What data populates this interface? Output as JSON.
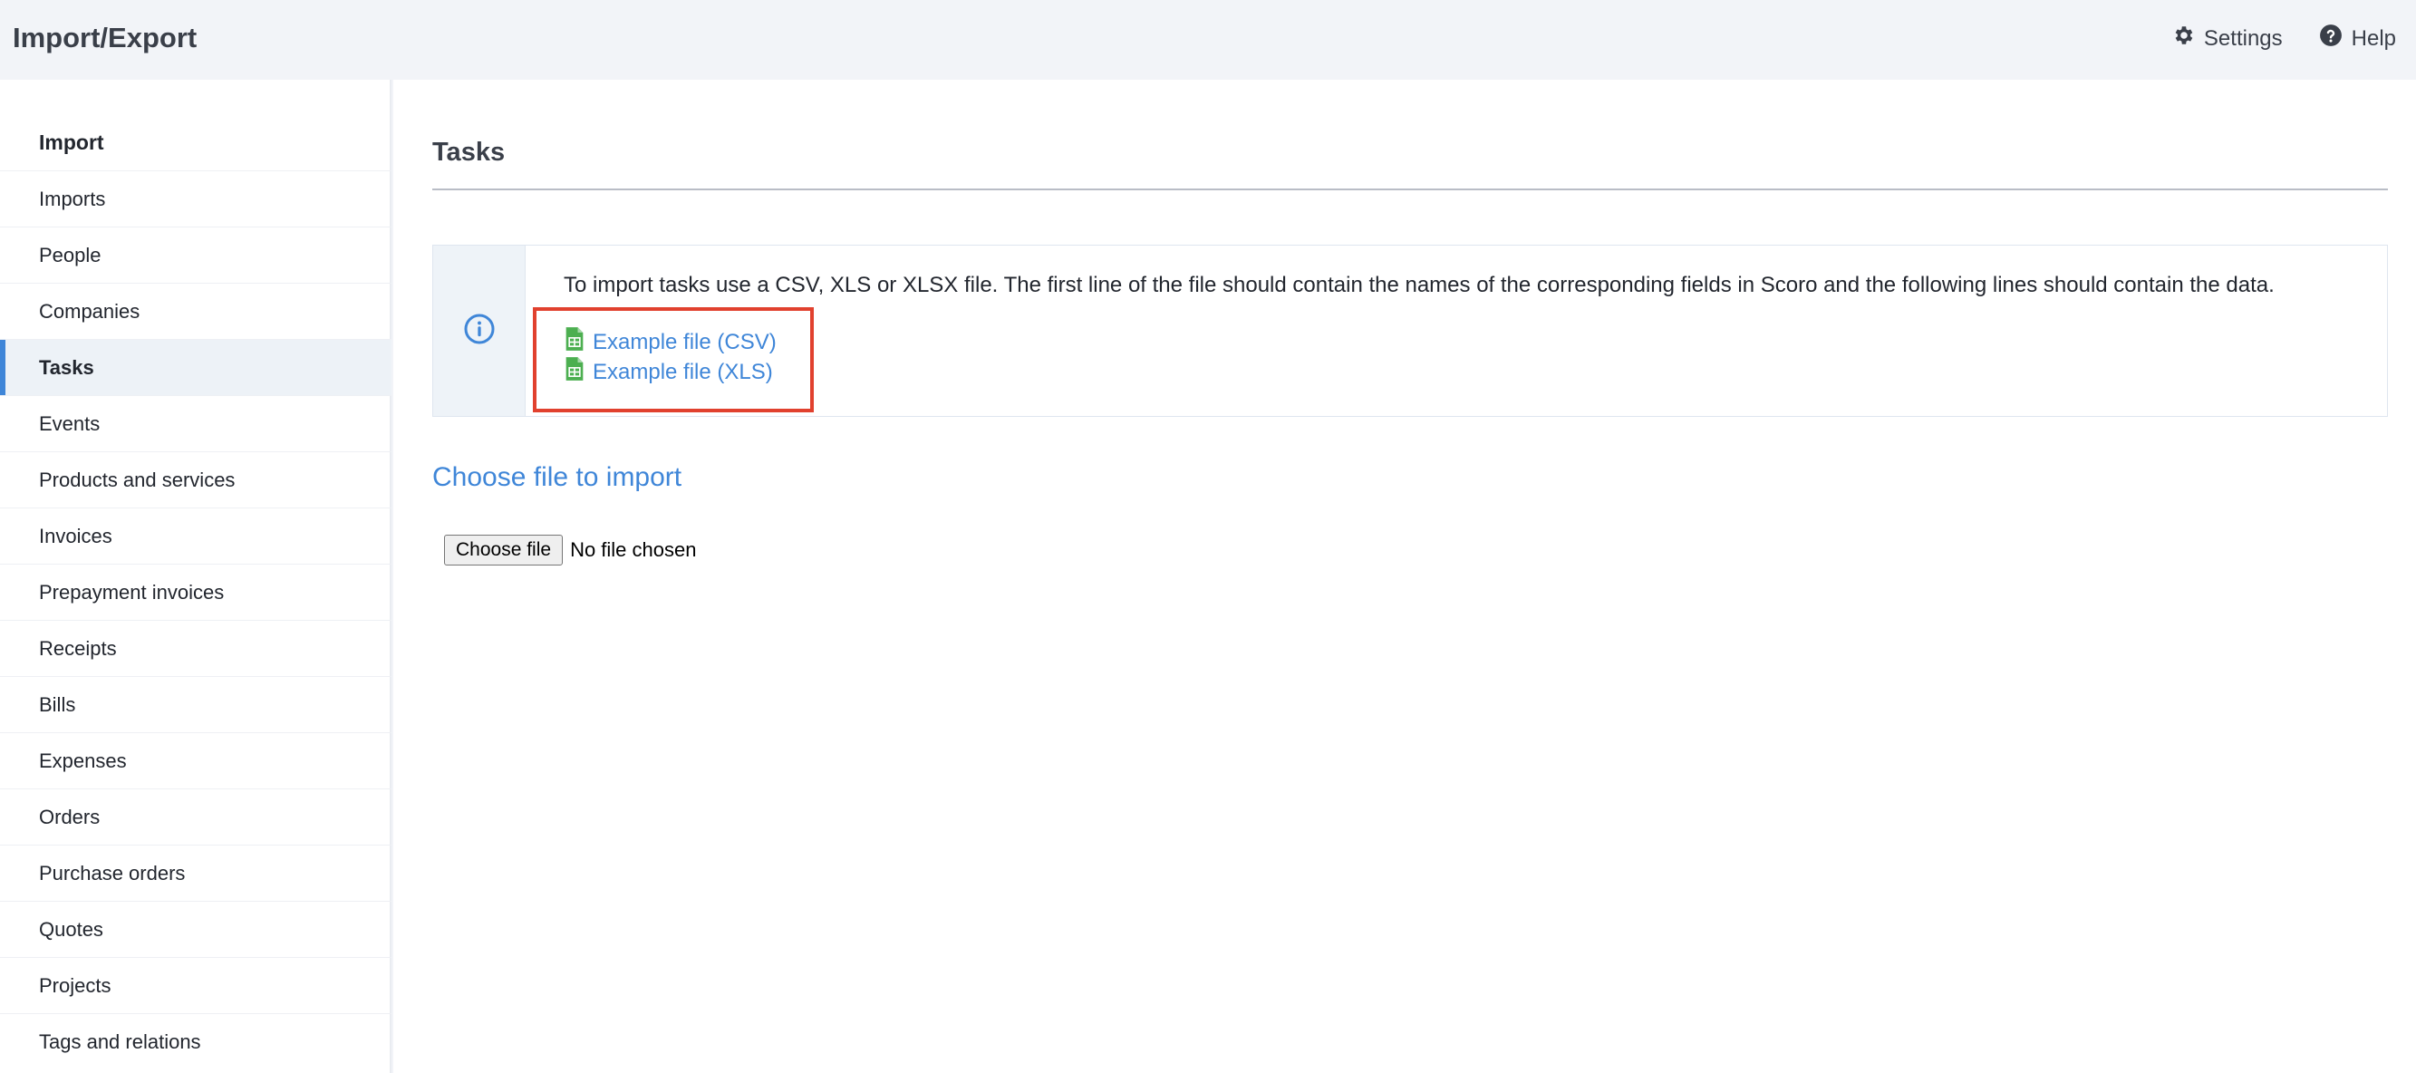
{
  "header": {
    "title": "Import/Export",
    "settings_label": "Settings",
    "help_label": "Help"
  },
  "sidebar": {
    "heading": "Import",
    "items": [
      {
        "label": "Imports"
      },
      {
        "label": "People"
      },
      {
        "label": "Companies"
      },
      {
        "label": "Tasks",
        "active": true
      },
      {
        "label": "Events"
      },
      {
        "label": "Products and services"
      },
      {
        "label": "Invoices"
      },
      {
        "label": "Prepayment invoices"
      },
      {
        "label": "Receipts"
      },
      {
        "label": "Bills"
      },
      {
        "label": "Expenses"
      },
      {
        "label": "Orders"
      },
      {
        "label": "Purchase orders"
      },
      {
        "label": "Quotes"
      },
      {
        "label": "Projects"
      },
      {
        "label": "Tags and relations"
      }
    ]
  },
  "main": {
    "title": "Tasks",
    "info_text": "To import tasks use a CSV, XLS or XLSX file. The first line of the file should contain the names of the corresponding fields in Scoro and the following lines should contain the data.",
    "example_csv": "Example file (CSV)",
    "example_xls": "Example file (XLS)",
    "choose_heading": "Choose file to import",
    "file_button_label": "Choose file",
    "file_status": "No file chosen"
  },
  "colors": {
    "accent": "#3f86d8",
    "highlight_border": "#e1412e",
    "file_icon": "#4caf50"
  },
  "icons": {
    "settings": "gear-icon",
    "help": "question-circle-icon",
    "info": "info-circle-icon",
    "spreadsheet": "spreadsheet-file-icon"
  }
}
